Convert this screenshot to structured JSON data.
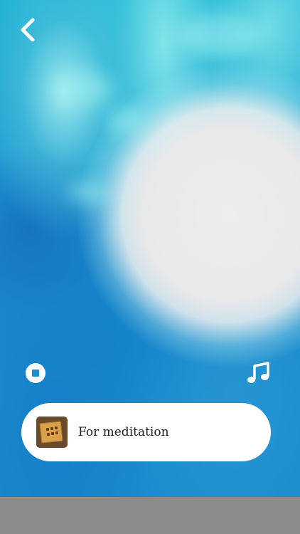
{
  "navigation": {
    "back_icon": "chevron-left-icon"
  },
  "controls": {
    "stop_icon": "stop-circle-icon",
    "music_icon": "music-note-icon"
  },
  "now_playing": {
    "title": "For meditation",
    "thumbnail_icon": "wooden-sign-thumbnail"
  },
  "colors": {
    "background_top": "#1fb3d6",
    "background_bottom": "#1b8ccd",
    "glow": "#ededed",
    "card": "#ffffff",
    "text": "#1b1b1b",
    "bottom_bar": "#8b8b8b"
  }
}
